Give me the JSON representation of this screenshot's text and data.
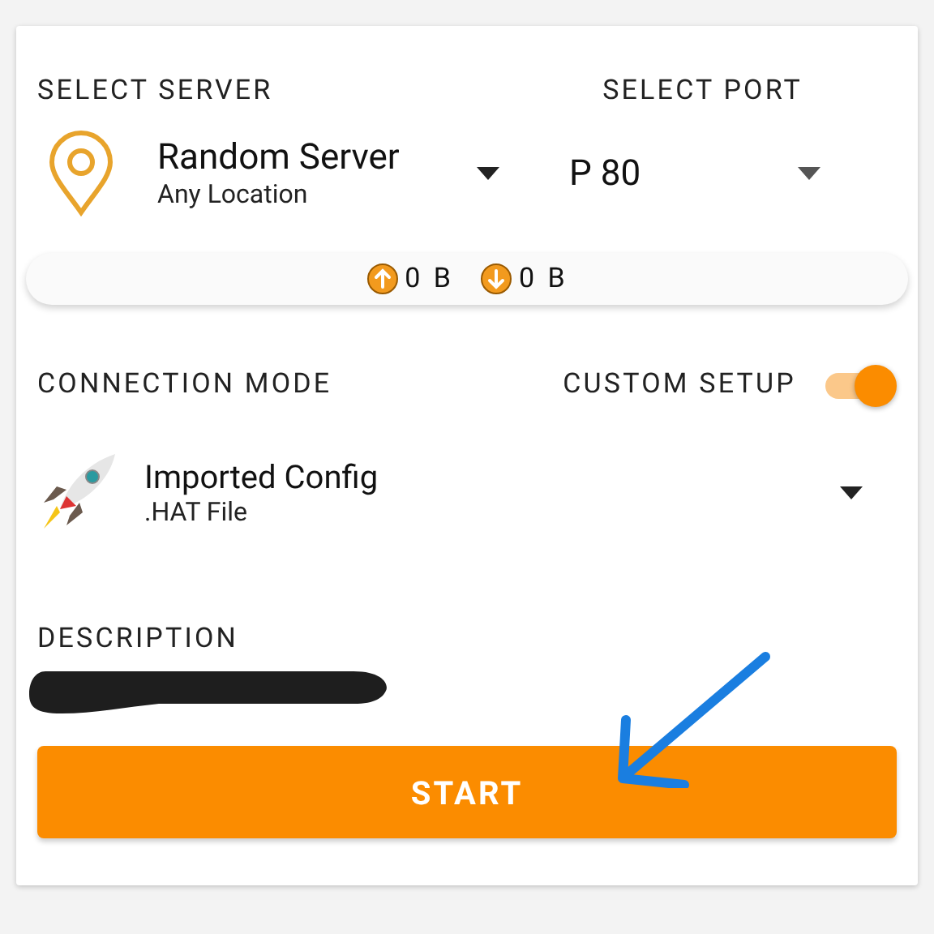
{
  "server": {
    "label": "SELECT SERVER",
    "name": "Random Server",
    "location": "Any Location"
  },
  "port": {
    "label": "SELECT PORT",
    "value": "P 80"
  },
  "traffic": {
    "upload": "0 B",
    "download": "0 B"
  },
  "connection_mode": {
    "label": "CONNECTION MODE",
    "custom_setup_label": "CUSTOM SETUP",
    "custom_setup_on": true,
    "config_name": "Imported Config",
    "config_type": ".HAT File"
  },
  "description": {
    "label": "DESCRIPTION",
    "redacted": true
  },
  "start_button": "START",
  "annotation_arrow": true
}
